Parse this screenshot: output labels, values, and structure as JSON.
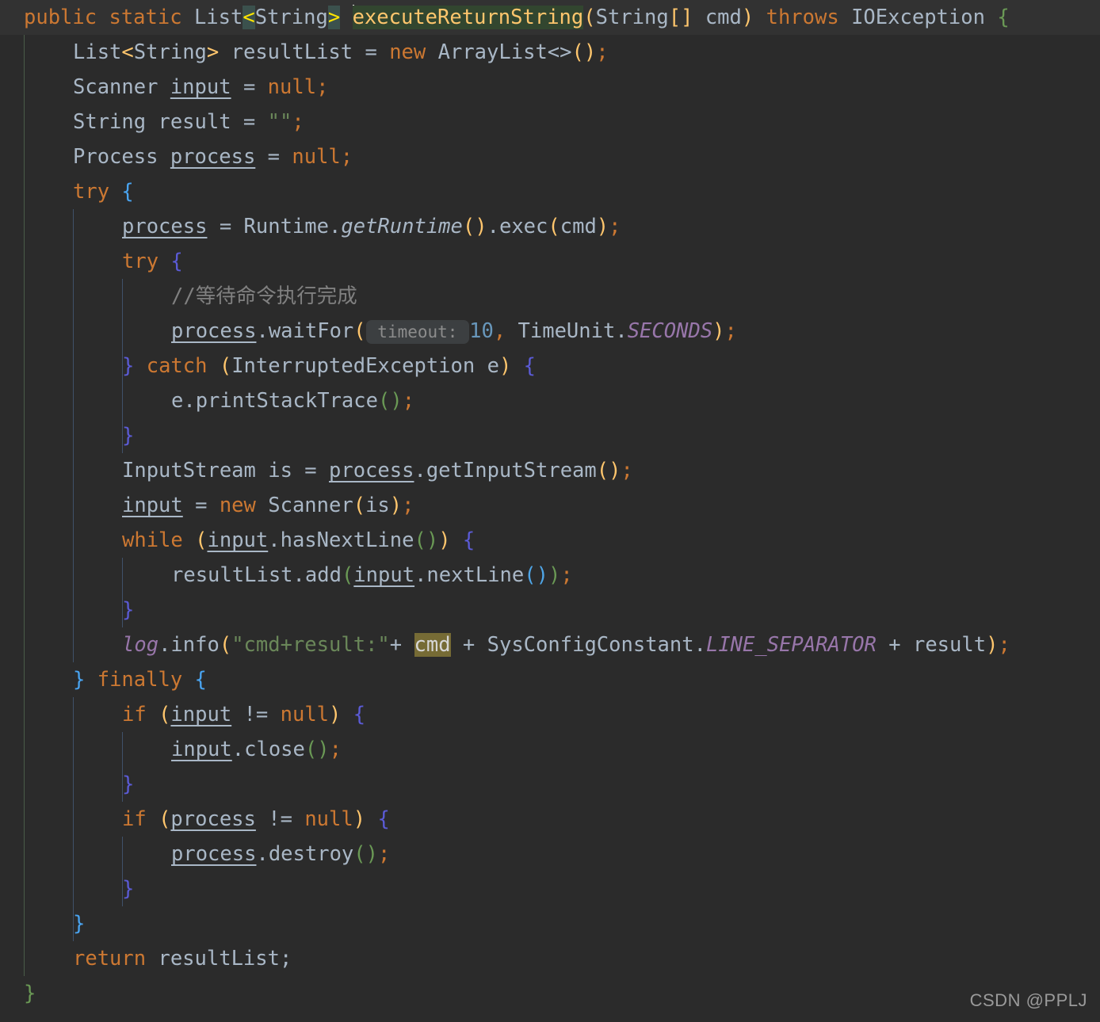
{
  "editor": {
    "app": "code-editor",
    "language": "java",
    "theme": "darcula",
    "background_color": "#2b2b2b",
    "current_line_color": "#323232",
    "default_text_color": "#a9b7c6"
  },
  "colors": {
    "keyword": "#cc7832",
    "string": "#6a8759",
    "number": "#6897bb",
    "comment": "#808080",
    "method": "#ffc66d",
    "static_field": "#9876aa",
    "bracket_yellow": "#ffc66d",
    "bracket_green": "#6a9955",
    "bracket_blue": "#49a3ef",
    "bracket_indigo": "#5b5bd6",
    "match_brace_highlight": "#3b514d",
    "identifier_highlight": "#32462f",
    "search_highlight": "#766b35",
    "indent_guide_green": "#4a5c48",
    "indent_guide_blue": "#3f5169",
    "caret": "#d8d8d8"
  },
  "code": {
    "line_01": {
      "t1": "public static ",
      "t2": "List",
      "t3": "<",
      "t4": "String",
      "t5": ">",
      "t6": " ",
      "t7": "executeReturnString",
      "t8": "(",
      "t9": "String",
      "t10": "[]",
      "t11": " cmd",
      "t12": ")",
      "t13": " throws ",
      "t14": "IOException",
      "t15": " ",
      "t16": "{"
    },
    "line_02": {
      "a": "List",
      "b": "<",
      "c": "String",
      "d": ">",
      "e": " resultList = ",
      "f": "new ",
      "g": "ArrayList<>",
      "h": "(",
      "i": ")",
      "j": ";"
    },
    "line_03": {
      "a": "Scanner ",
      "b": "input",
      "c": " = ",
      "d": "null",
      "e": ";"
    },
    "line_04": {
      "a": "String result = ",
      "b": "\"\"",
      "c": ";"
    },
    "line_05": {
      "a": "Process ",
      "b": "process",
      "c": " = ",
      "d": "null",
      "e": ";"
    },
    "line_06": {
      "a": "try ",
      "b": "{"
    },
    "line_07": {
      "a": "process",
      "b": " = Runtime.",
      "c": "getRuntime",
      "d": "(",
      "e": ")",
      "f": ".exec",
      "g": "(",
      "h": "cmd",
      "i": ")",
      "j": ";"
    },
    "line_08": {
      "a": "try ",
      "b": "{"
    },
    "line_09": {
      "a": "//等待命令执行完成"
    },
    "line_10": {
      "a": "process",
      "b": ".waitFor",
      "c": "(",
      "d": " timeout: ",
      "e": "10",
      "f": ",",
      "g": " TimeUnit.",
      "h": "SECONDS",
      "i": ")",
      "j": ";"
    },
    "line_11": {
      "a": "}",
      "b": " catch ",
      "c": "(",
      "d": "InterruptedException e",
      "e": ")",
      "f": " ",
      "g": "{"
    },
    "line_12": {
      "a": "e.printStackTrace",
      "b": "(",
      "c": ")",
      "d": ";"
    },
    "line_13": {
      "a": "}"
    },
    "line_14": {
      "a": "InputStream is = ",
      "b": "process",
      "c": ".getInputStream",
      "d": "(",
      "e": ")",
      "f": ";"
    },
    "line_15": {
      "a": "input",
      "b": " = ",
      "c": "new ",
      "d": "Scanner",
      "e": "(",
      "f": "is",
      "g": ")",
      "h": ";"
    },
    "line_16": {
      "a": "while ",
      "b": "(",
      "c": "input",
      "d": ".hasNextLine",
      "e": "(",
      "f": ")",
      "g": ")",
      "h": " ",
      "i": "{"
    },
    "line_17": {
      "a": "resultList.add",
      "b": "(",
      "c": "input",
      "d": ".nextLine",
      "e": "(",
      "f": ")",
      "g": ")",
      "h": ";"
    },
    "line_18": {
      "a": "}"
    },
    "line_19": {
      "a": "log",
      "b": ".info",
      "c": "(",
      "d": "\"cmd+result:\"",
      "e": "+ ",
      "f": "cmd",
      "g": " + SysConfigConstant.",
      "h": "LINE_SEPARATOR",
      "i": " + result",
      "j": ")",
      "k": ";"
    },
    "line_20": {
      "a": "}",
      "b": " finally ",
      "c": "{"
    },
    "line_21": {
      "a": "if ",
      "b": "(",
      "c": "input",
      "d": " != ",
      "e": "null",
      "f": ")",
      "g": " ",
      "h": "{"
    },
    "line_22": {
      "a": "input",
      "b": ".close",
      "c": "(",
      "d": ")",
      "e": ";"
    },
    "line_23": {
      "a": "}"
    },
    "line_24": {
      "a": "if ",
      "b": "(",
      "c": "process",
      "d": " != ",
      "e": "null",
      "f": ")",
      "g": " ",
      "h": "{"
    },
    "line_25": {
      "a": "process",
      "b": ".destroy",
      "c": "(",
      "d": ")",
      "e": ";"
    },
    "line_26": {
      "a": "}"
    },
    "line_27": {
      "a": "}"
    },
    "line_28": {
      "a": "return ",
      "b": "resultList;"
    },
    "line_29": {
      "a": "}"
    }
  },
  "parameter_hints": {
    "timeout_label": " timeout: "
  },
  "watermark": {
    "text": "CSDN @PPLJ"
  }
}
